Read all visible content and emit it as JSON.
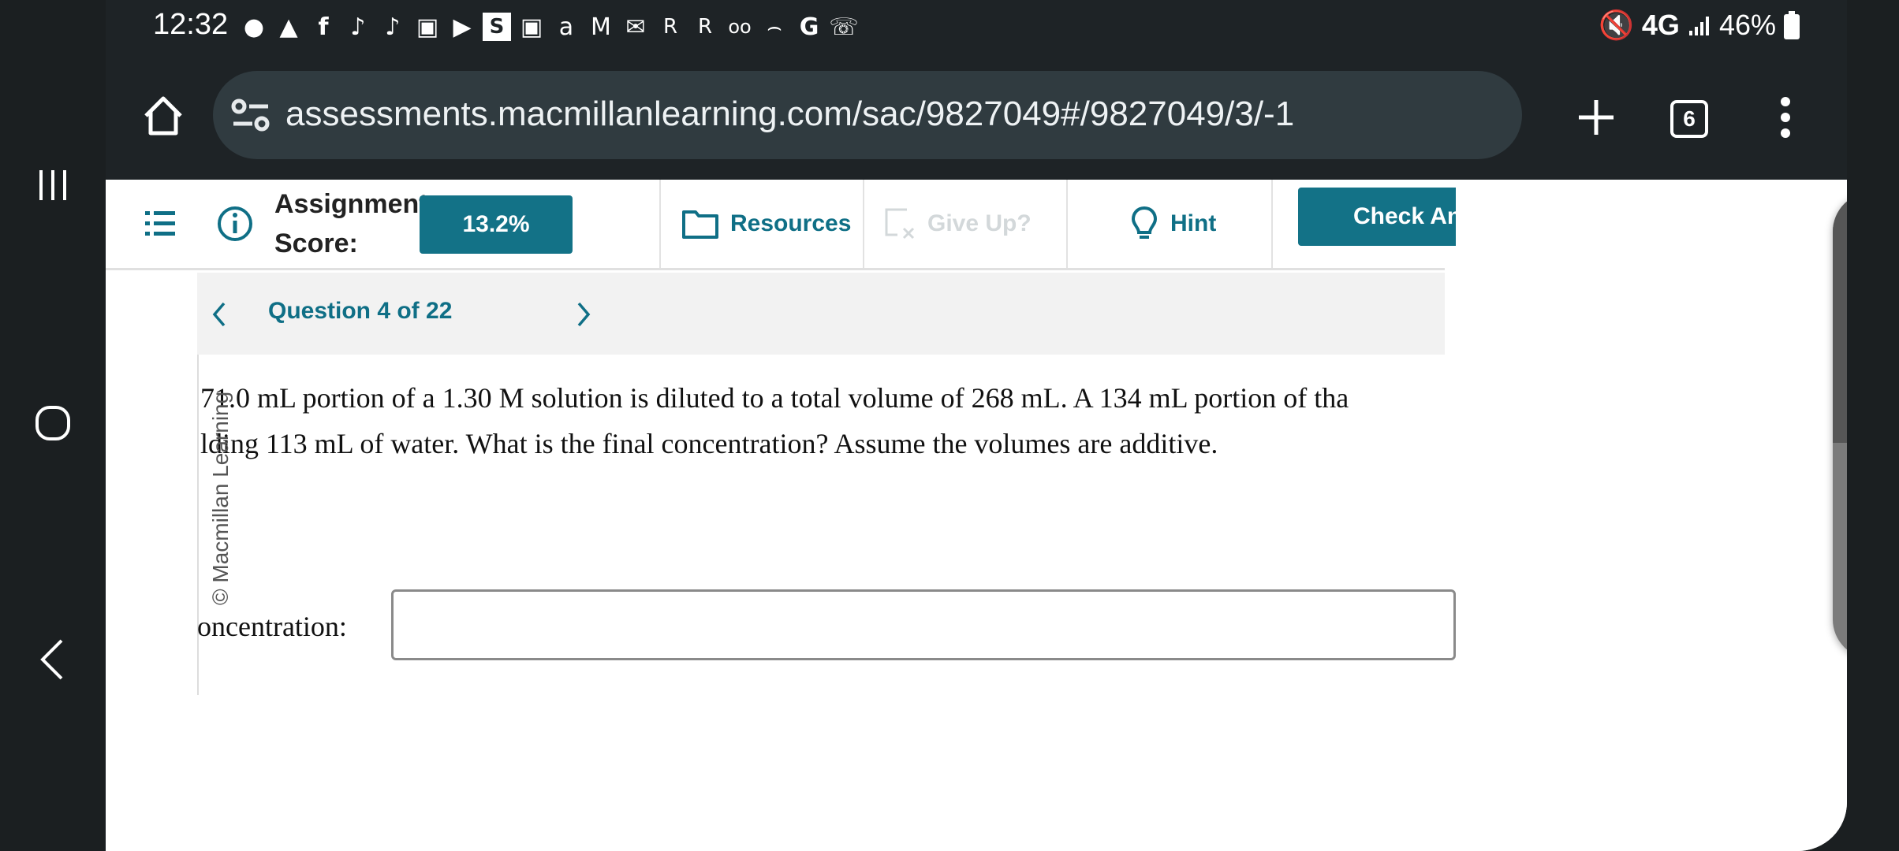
{
  "status_bar": {
    "time": "12:32",
    "network": "4G",
    "battery": "46%",
    "notification_icons": [
      "chat-icon",
      "snapchat-icon",
      "facebook-icon",
      "tiktok-icon",
      "tiktok-icon",
      "instagram-icon",
      "youtube-icon",
      "s-app-icon",
      "instagram-icon",
      "airbnb-icon",
      "gmail-icon",
      "outlook-icon",
      "r-app-icon",
      "r-app-icon",
      "voicemail-icon",
      "amazon-icon",
      "google-icon",
      "phone-icon"
    ]
  },
  "browser": {
    "url": "assessments.macmillanlearning.com/sac/9827049#/9827049/3/-1",
    "tab_count": "6"
  },
  "toolbar": {
    "assignment_label_line1": "Assignment",
    "assignment_label_line2": "Score:",
    "score": "13.2%",
    "resources": "Resources",
    "give_up": "Give Up?",
    "hint": "Hint",
    "check_answer": "Check An"
  },
  "question_nav": {
    "label": "Question 4 of 22"
  },
  "question": {
    "line1": "71.0 mL portion of a 1.30 M solution is diluted to a total volume of 268 mL. A 134 mL portion of tha",
    "line2": "lding 113 mL of water. What is the final concentration? Assume the volumes are additive.",
    "copyright": "© Macmillan Learning",
    "answer_label": "oncentration:",
    "answer_value": ""
  },
  "colors": {
    "accent": "#137287",
    "chrome": "#1e2326",
    "urlbar": "#303b40"
  }
}
